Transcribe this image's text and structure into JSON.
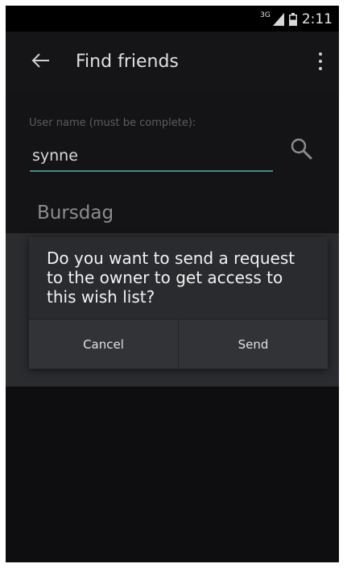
{
  "status_bar": {
    "network": "3G",
    "time": "2:11"
  },
  "action_bar": {
    "title": "Find friends",
    "back_icon": "arrow-left-icon",
    "overflow_icon": "more-vert-icon"
  },
  "search": {
    "label": "User name (must be complete):",
    "value": "synne",
    "icon": "search-icon",
    "accent": "#3d8f87"
  },
  "results": [
    {
      "label": "Bursdag"
    }
  ],
  "dialog": {
    "message": "Do you want to send a request to the owner to get access to this wish list?",
    "cancel_label": "Cancel",
    "send_label": "Send"
  }
}
